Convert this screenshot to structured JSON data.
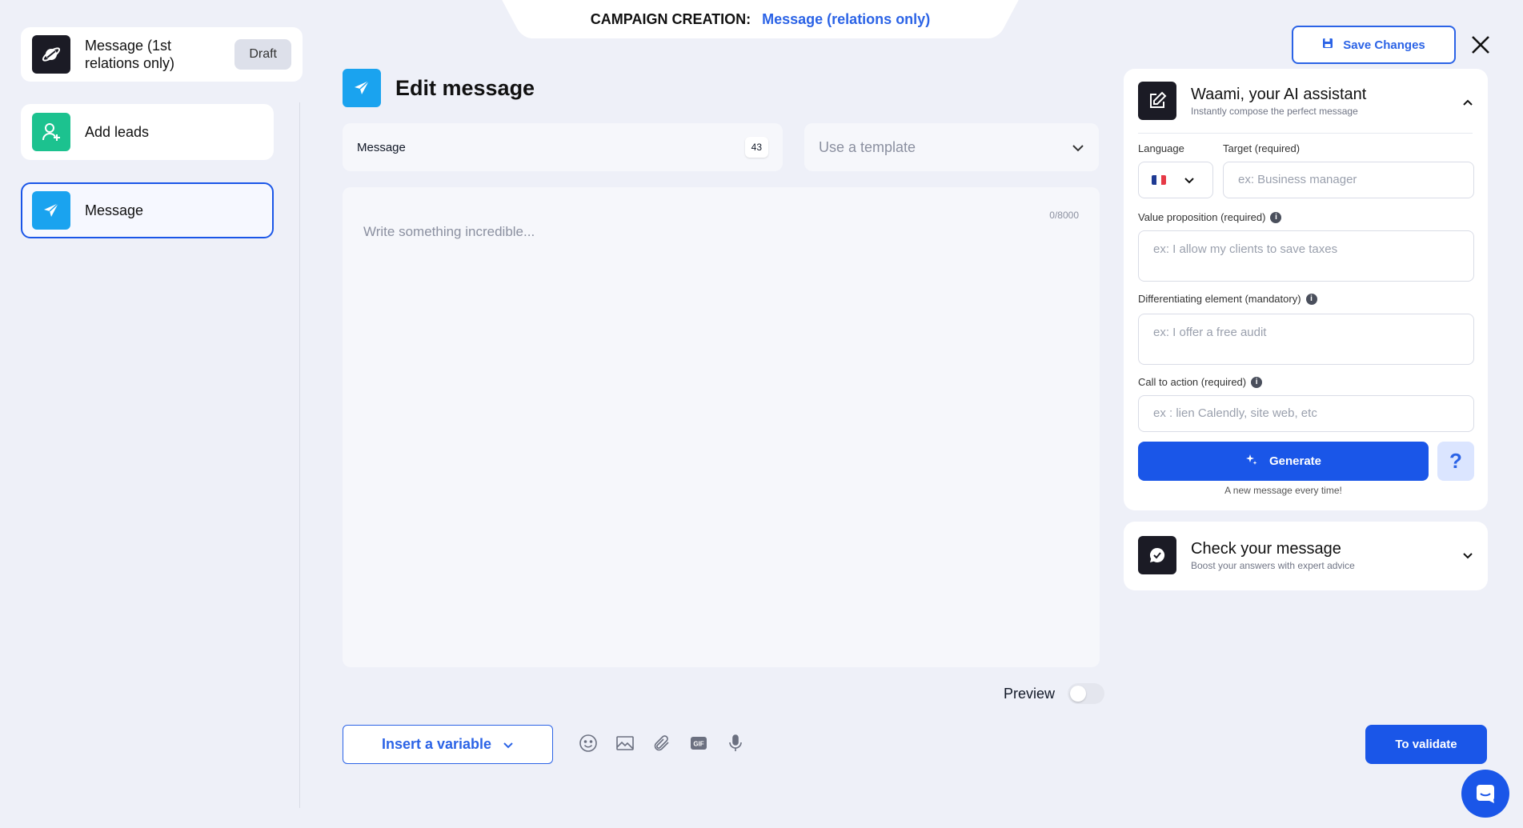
{
  "campaign_tab": {
    "label": "CAMPAIGN CREATION:",
    "value": "Message (relations only)"
  },
  "sidebar": {
    "campaign": {
      "title": "Message (1st relations only)",
      "badge": "Draft",
      "icon": "planet-icon"
    },
    "steps": [
      {
        "label": "Add leads",
        "icon": "add-user-icon",
        "color": "#1cc28f"
      },
      {
        "label": "Message",
        "icon": "send-icon",
        "color": "#1aa3ef",
        "active": true
      }
    ]
  },
  "editor": {
    "title": "Edit message",
    "message_field_label": "Message",
    "message_count": "43",
    "template_placeholder": "Use a template",
    "body_placeholder": "Write something incredible...",
    "char_limit": "0/8000",
    "preview_label": "Preview",
    "insert_variable": "Insert a variable",
    "toolbar_icons": [
      "emoji-icon",
      "image-icon",
      "attachment-icon",
      "gif-icon",
      "microphone-icon"
    ],
    "gif_text": "GIF",
    "validate": "To validate"
  },
  "header": {
    "save_changes": "Save Changes"
  },
  "ai_assistant": {
    "title": "Waami, your AI assistant",
    "subtitle": "Instantly compose the perfect message",
    "language_label": "Language",
    "target_label": "Target (required)",
    "target_placeholder": "ex: Business manager",
    "value_prop_label": "Value proposition (required)",
    "value_prop_placeholder": "ex: I allow my clients to save taxes",
    "diff_label": "Differentiating element (mandatory)",
    "diff_placeholder": "ex: I offer a free audit",
    "cta_label": "Call to action (required)",
    "cta_placeholder": "ex : lien Calendly, site web, etc",
    "generate": "Generate",
    "help": "?",
    "generate_note": "A new message every time!"
  },
  "check_message": {
    "title": "Check your message",
    "subtitle": "Boost your answers with expert advice"
  },
  "colors": {
    "accent": "#1a56e8",
    "background": "#eef0f8",
    "green": "#1cc28f",
    "cyan": "#1aa3ef"
  }
}
